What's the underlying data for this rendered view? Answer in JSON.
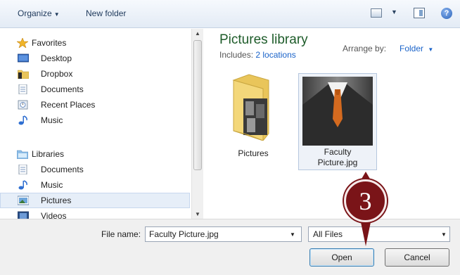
{
  "toolbar": {
    "organize_label": "Organize",
    "new_folder_label": "New folder",
    "views_icon": "views-icon",
    "preview_pane_icon": "preview-pane-icon",
    "help_icon": "help-icon"
  },
  "nav": {
    "favorites_label": "Favorites",
    "favorites_items": [
      {
        "label": "Desktop",
        "icon": "desktop-icon"
      },
      {
        "label": "Dropbox",
        "icon": "folder-icon"
      },
      {
        "label": "Documents",
        "icon": "document-icon"
      },
      {
        "label": "Recent Places",
        "icon": "recent-places-icon"
      },
      {
        "label": "Music",
        "icon": "music-icon"
      }
    ],
    "libraries_label": "Libraries",
    "libraries_items": [
      {
        "label": "Documents",
        "icon": "document-icon"
      },
      {
        "label": "Music",
        "icon": "music-icon"
      },
      {
        "label": "Pictures",
        "icon": "pictures-icon",
        "selected": true
      },
      {
        "label": "Videos",
        "icon": "videos-icon"
      }
    ]
  },
  "content": {
    "title": "Pictures library",
    "includes_prefix": "Includes:",
    "includes_link": "2 locations",
    "arrange_label": "Arrange by:",
    "arrange_value": "Folder",
    "items": [
      {
        "label": "Pictures",
        "type": "folder"
      },
      {
        "label_line1": "Faculty",
        "label_line2": "Picture.jpg",
        "type": "image",
        "selected": true
      }
    ]
  },
  "footer": {
    "file_name_label": "File name:",
    "file_name_value": "Faculty Picture.jpg",
    "file_type_value": "All Files",
    "open_label": "Open",
    "cancel_label": "Cancel"
  },
  "callout": {
    "step": "3",
    "color": "#7a1418"
  }
}
